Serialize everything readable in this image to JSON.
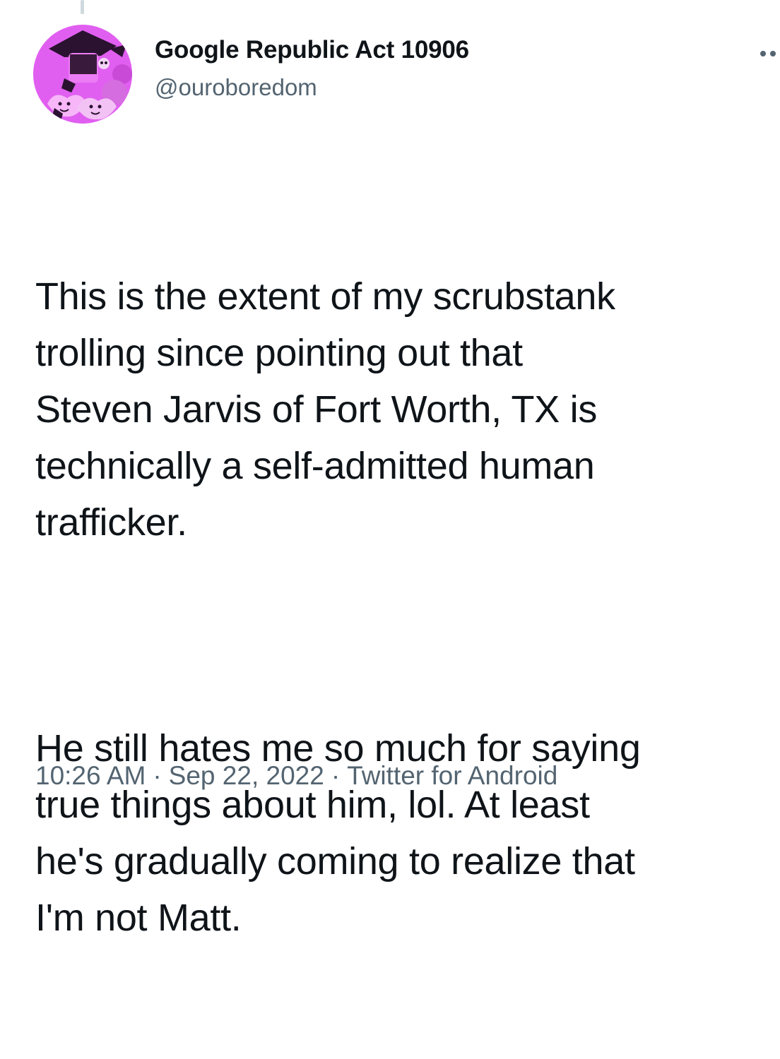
{
  "author": {
    "display_name": "Google Republic Act 10906",
    "handle": "@ouroboredom",
    "avatar_icon": "avatar-image",
    "avatar_color": "#e15ff0"
  },
  "menu": {
    "more_icon": "more-options-icon"
  },
  "tweet": {
    "paragraphs": [
      "This is the extent of my scrubstank\ntrolling since pointing out that\nSteven Jarvis of Fort Worth, TX is\ntechnically a self-admitted human\ntrafficker.",
      "He still hates me so much for saying\ntrue things about him, lol. At least\nhe's gradually coming to realize that\nI'm not Matt."
    ]
  },
  "meta": {
    "time": "10:26 AM",
    "date": "Sep 22, 2022",
    "source": "Twitter for Android",
    "separator": "·"
  },
  "colors": {
    "text_primary": "#0f1419",
    "text_secondary": "#536471",
    "background": "#ffffff"
  }
}
